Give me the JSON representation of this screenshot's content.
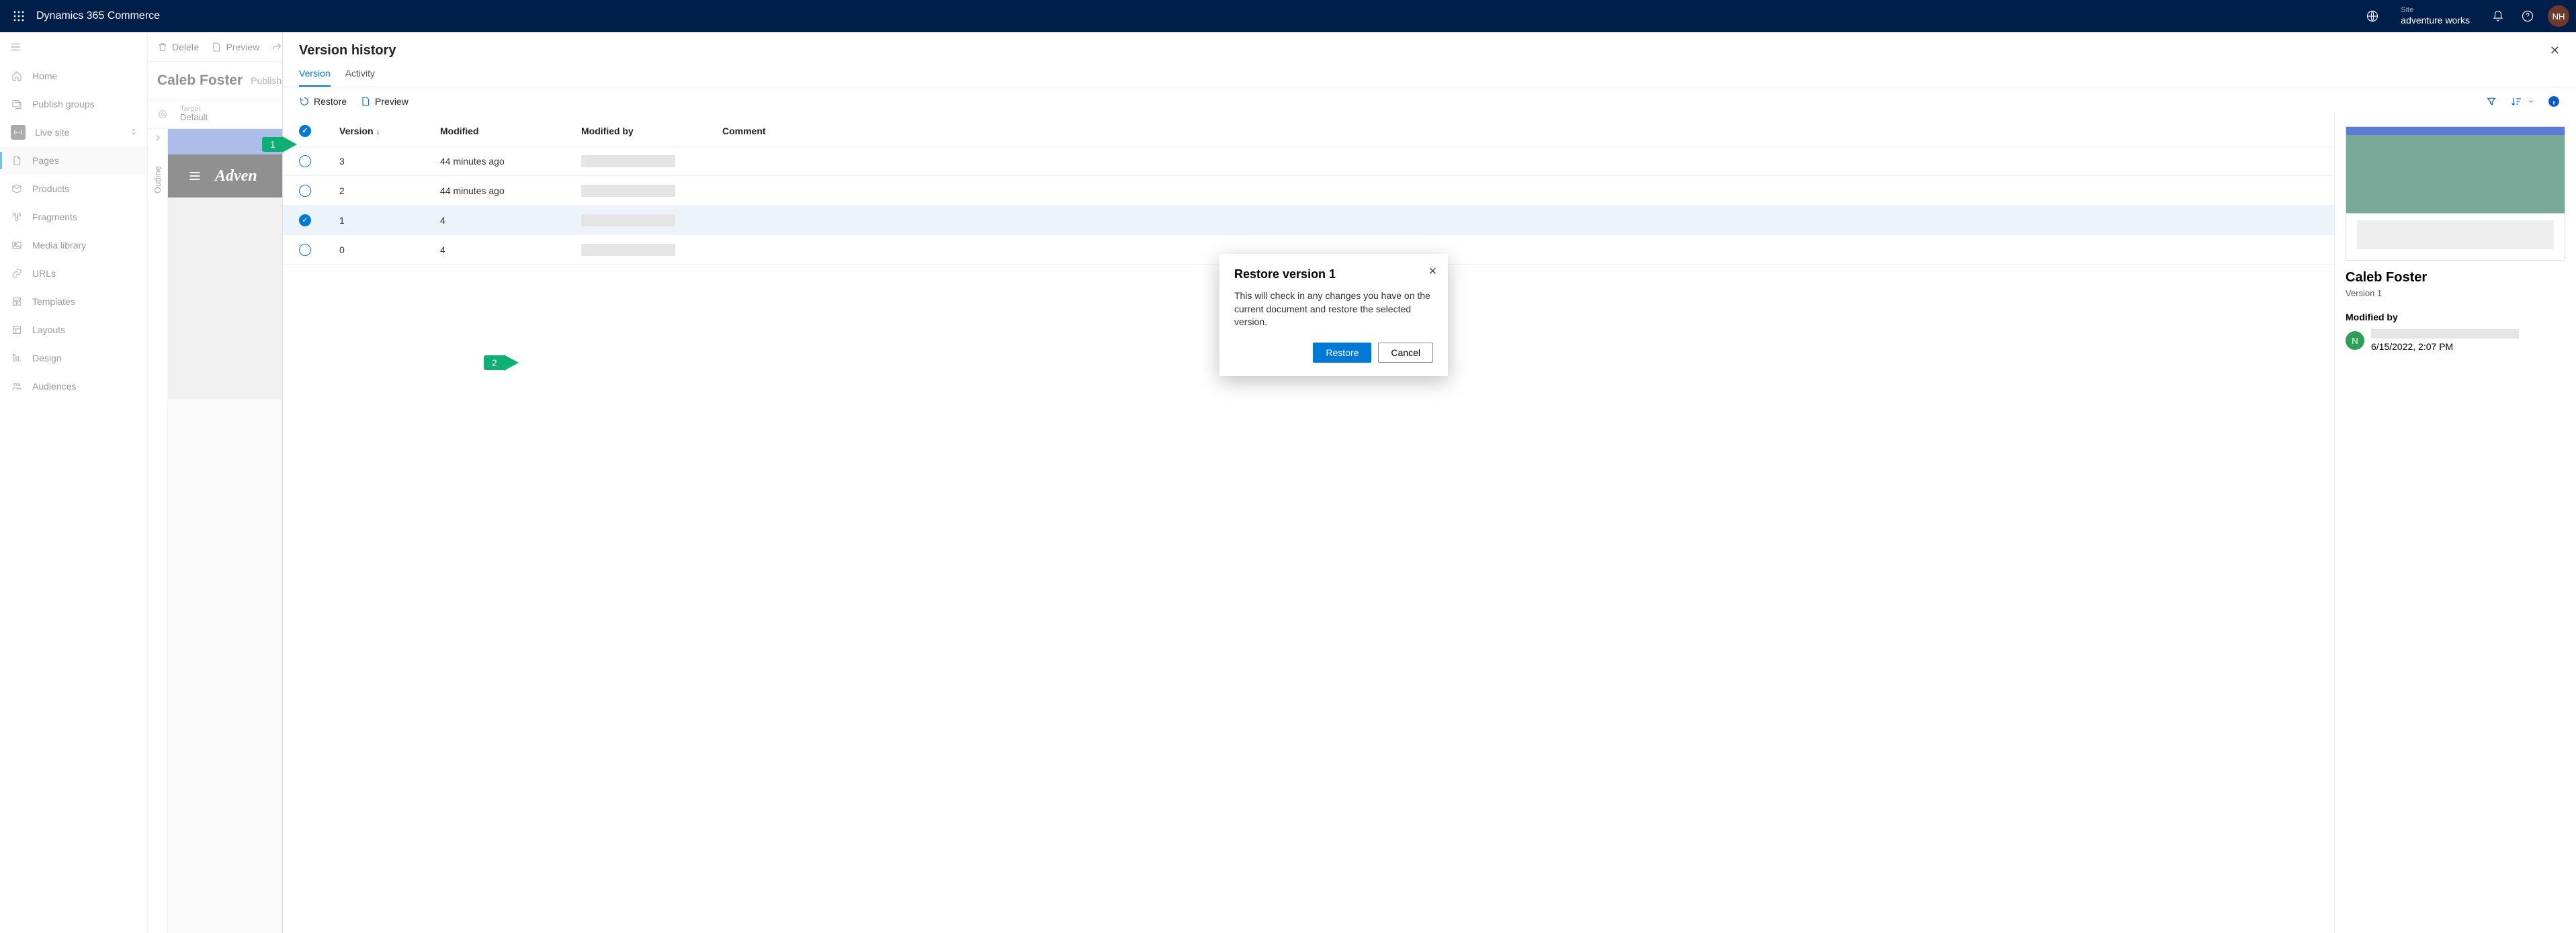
{
  "topbar": {
    "brand": "Dynamics 365 Commerce",
    "site_label": "Site",
    "site_value": "adventure works",
    "avatar_initials": "NH"
  },
  "leftnav": {
    "items": [
      {
        "label": "Home"
      },
      {
        "label": "Publish groups"
      },
      {
        "label": "Live site"
      },
      {
        "label": "Pages"
      },
      {
        "label": "Products"
      },
      {
        "label": "Fragments"
      },
      {
        "label": "Media library"
      },
      {
        "label": "URLs"
      },
      {
        "label": "Templates"
      },
      {
        "label": "Layouts"
      },
      {
        "label": "Design"
      },
      {
        "label": "Audiences"
      }
    ]
  },
  "cmdbar": {
    "delete": "Delete",
    "preview": "Preview",
    "share_tail": "S"
  },
  "page": {
    "title": "Caleb Foster",
    "status": "Published,",
    "target_label": "Target",
    "target_value": "Default",
    "outline_label": "Outline",
    "header_logo": "Adven"
  },
  "panel": {
    "title": "Version history",
    "tabs": {
      "version": "Version",
      "activity": "Activity"
    },
    "tools": {
      "restore": "Restore",
      "preview": "Preview"
    },
    "columns": {
      "version": "Version",
      "modified": "Modified",
      "modified_by": "Modified by",
      "comment": "Comment"
    },
    "rows": [
      {
        "selected": false,
        "version": "3",
        "modified": "44 minutes ago"
      },
      {
        "selected": false,
        "version": "2",
        "modified": "44 minutes ago"
      },
      {
        "selected": true,
        "version": "1",
        "modified": "4"
      },
      {
        "selected": false,
        "version": "0",
        "modified": "4"
      }
    ],
    "side": {
      "title": "Caleb Foster",
      "subtitle": "Version 1",
      "modified_by_label": "Modified by",
      "avatar": "N",
      "timestamp": "6/15/2022, 2:07 PM"
    }
  },
  "modal": {
    "title": "Restore version 1",
    "body": "This will check in any changes you have on the current document and restore the selected version.",
    "restore": "Restore",
    "cancel": "Cancel"
  },
  "callouts": {
    "one": "1",
    "two": "2"
  }
}
